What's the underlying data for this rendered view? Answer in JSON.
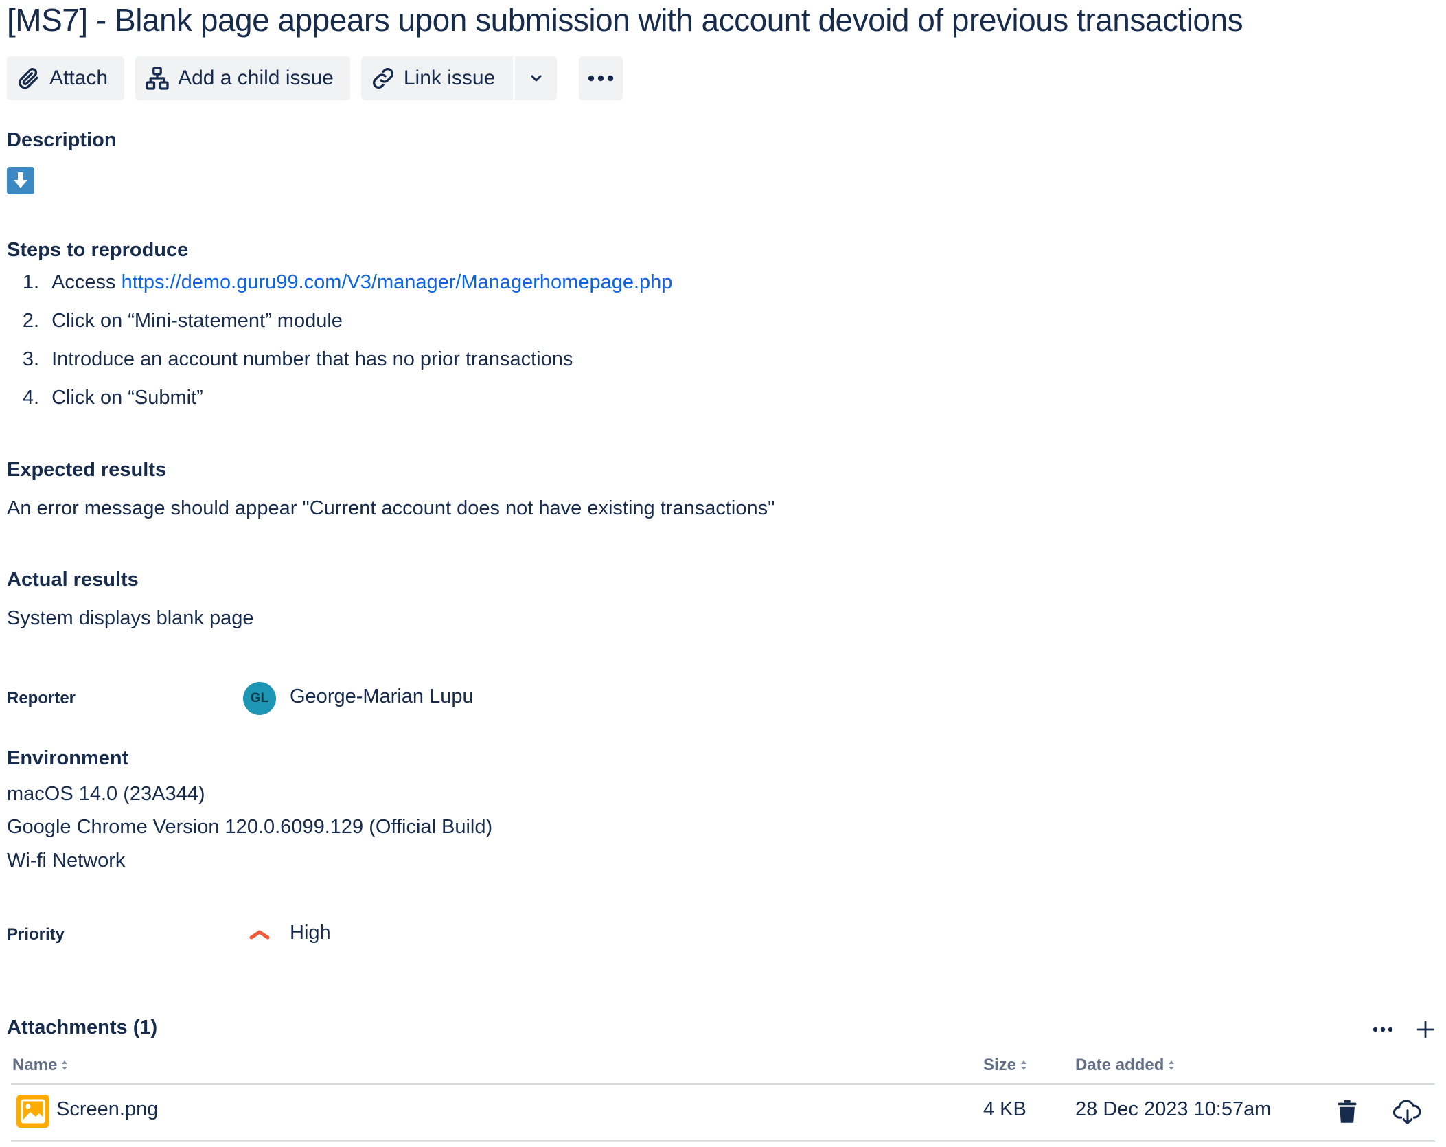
{
  "issue": {
    "title": "[MS7] - Blank page appears upon submission with account devoid of previous transactions"
  },
  "toolbar": {
    "attach_label": "Attach",
    "add_child_label": "Add a child issue",
    "link_label": "Link issue"
  },
  "description": {
    "heading": "Description",
    "steps_heading": "Steps to reproduce",
    "steps": [
      {
        "num": "1.",
        "prefix": "Access ",
        "link": "https://demo.guru99.com/V3/manager/Managerhomepage.php"
      },
      {
        "num": "2.",
        "text": "Click on “Mini-statement” module"
      },
      {
        "num": "3.",
        "text": "Introduce an account number that has no prior transactions"
      },
      {
        "num": "4.",
        "text": "Click on “Submit”"
      }
    ],
    "expected_heading": "Expected results",
    "expected_text": "An error message should appear \"Current account does not have existing transactions\"",
    "actual_heading": "Actual results",
    "actual_text": "System displays blank page"
  },
  "reporter": {
    "label": "Reporter",
    "initials": "GL",
    "name": "George-Marian Lupu",
    "avatar_color": "#1d96b3"
  },
  "environment": {
    "heading": "Environment",
    "lines": [
      "macOS 14.0 (23A344)",
      "Google Chrome Version 120.0.6099.129 (Official Build)",
      "Wi-fi Network"
    ]
  },
  "priority": {
    "label": "Priority",
    "value": "High",
    "icon": "priority-high-chevron-icon",
    "color": "#f15b3a"
  },
  "attachments": {
    "heading": "Attachments (1)",
    "columns": {
      "name": "Name",
      "size": "Size",
      "date": "Date added"
    },
    "files": [
      {
        "name": "Screen.png",
        "size": "4 KB",
        "date": "28 Dec 2023 10:57am",
        "icon": "image-file-icon"
      }
    ]
  },
  "colors": {
    "text": "#172b4d",
    "link": "#0c66e4",
    "button_bg": "#f1f2f4",
    "muted": "#626f86",
    "file_icon": "#ffab00"
  }
}
